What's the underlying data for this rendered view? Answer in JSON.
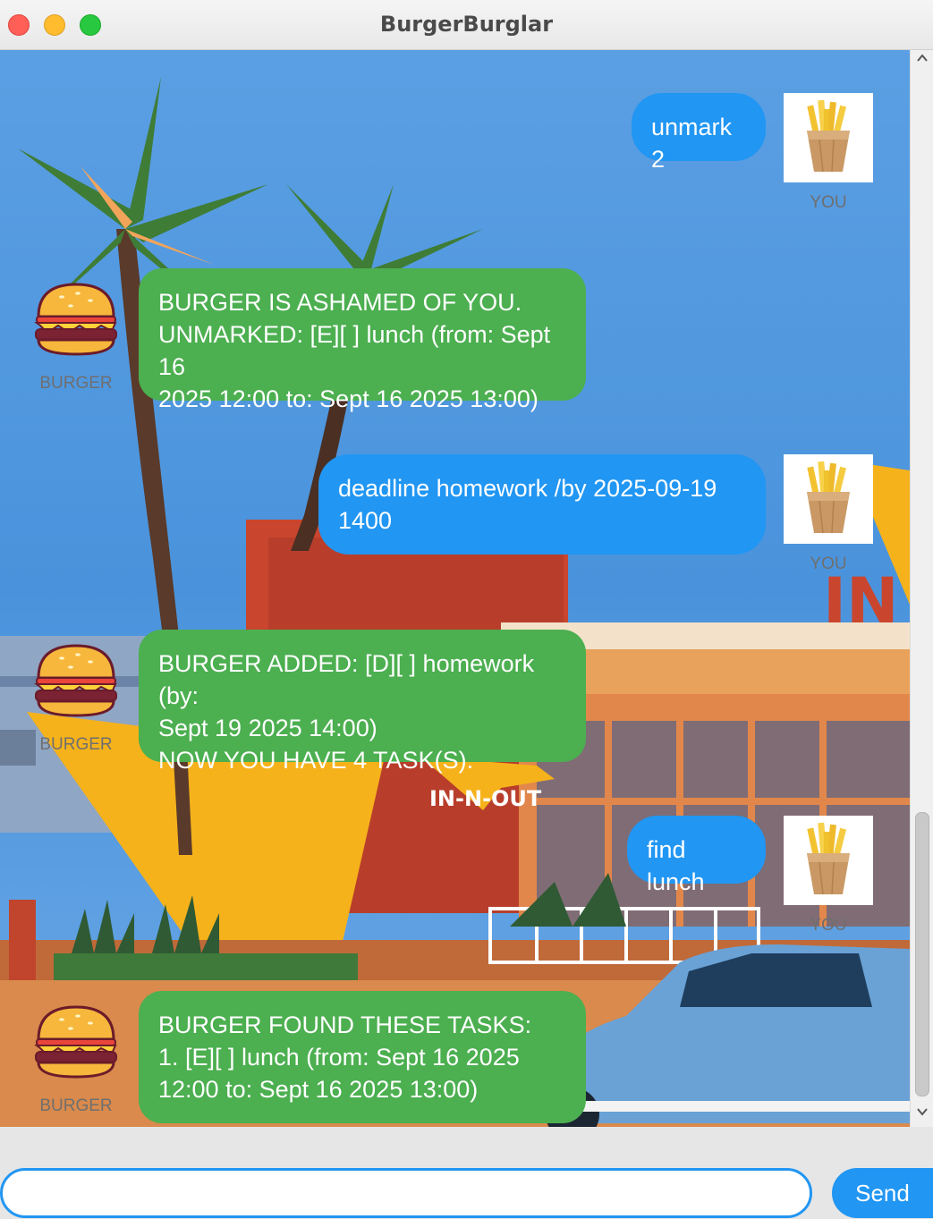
{
  "window": {
    "title": "BurgerBurglar"
  },
  "messages": [
    {
      "sender": "user",
      "text": "unmark 2",
      "caption": "YOU"
    },
    {
      "sender": "bot",
      "text": "BURGER IS ASHAMED OF YOU.\nUNMARKED: [E][ ] lunch (from: Sept 16\n2025 12:00 to: Sept 16 2025 13:00)",
      "caption": "BURGER"
    },
    {
      "sender": "user",
      "text": "deadline homework /by 2025-09-19\n1400",
      "caption": "YOU"
    },
    {
      "sender": "bot",
      "text": "BURGER ADDED: [D][ ] homework (by:\nSept 19 2025 14:00)\nNOW YOU HAVE 4 TASK(S).",
      "caption": "BURGER"
    },
    {
      "sender": "user",
      "text": "find lunch",
      "caption": "YOU"
    },
    {
      "sender": "bot",
      "text": "BURGER FOUND THESE TASKS:\n1. [E][ ] lunch (from: Sept 16 2025\n12:00 to: Sept 16 2025 13:00)",
      "caption": "BURGER"
    }
  ],
  "background": {
    "sign_small": "IN-N-OUT",
    "sign_large": "IN"
  },
  "input": {
    "value": "",
    "placeholder": ""
  },
  "send": {
    "label": "Send"
  },
  "icons": {
    "user_avatar": "french-fries-icon",
    "bot_avatar": "burger-icon",
    "scroll_up": "chevron-up-icon",
    "scroll_down": "chevron-down-icon"
  },
  "colors": {
    "user_bubble": "#2196f3",
    "bot_bubble": "#4caf50",
    "send_button": "#2196f3"
  }
}
